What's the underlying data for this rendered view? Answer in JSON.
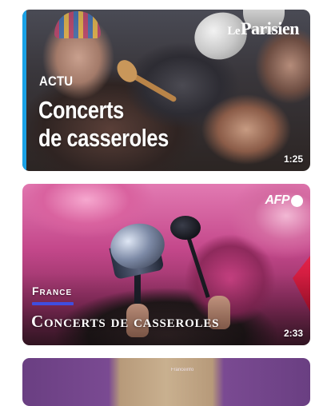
{
  "feed": {
    "cards": [
      {
        "source": {
          "prefix": "Le",
          "name": "Parisien"
        },
        "kicker": "ACTU",
        "title_line1": "Concerts",
        "title_line2": "de casseroles",
        "duration": "1:25",
        "accent_color": "#1aa2e6"
      },
      {
        "source": {
          "name": "AFP"
        },
        "kicker": "France",
        "title": "Concerts de casseroles",
        "duration": "2:33",
        "accent_color": "#3f4ee0"
      },
      {
        "partial_label": "Franceinfo"
      }
    ]
  }
}
